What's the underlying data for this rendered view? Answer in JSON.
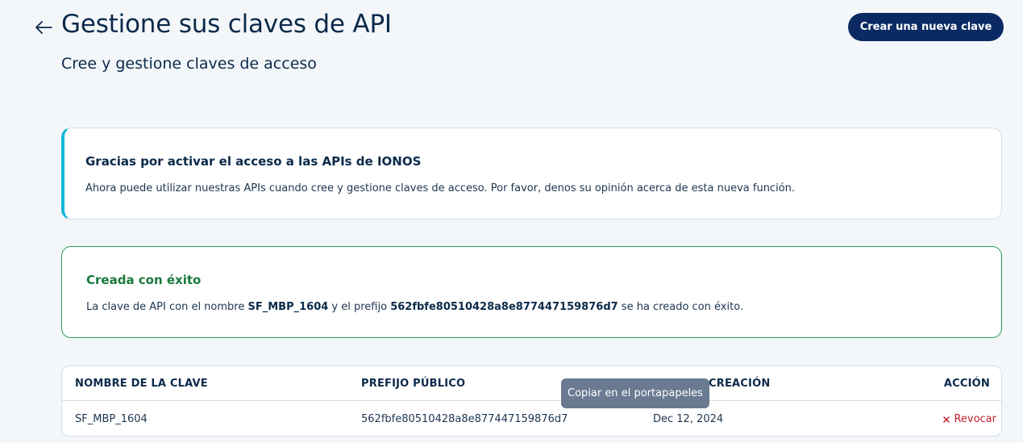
{
  "header": {
    "title": "Gestione sus claves de API",
    "subtitle": "Cree y gestione claves de acceso",
    "create_button_label": "Crear una nueva clave"
  },
  "info_card": {
    "title": "Gracias por activar el acceso a las APIs de IONOS",
    "text": "Ahora puede utilizar nuestras APIs cuando cree y gestione claves de acceso. Por favor, denos su opinión acerca de esta nueva función."
  },
  "success_card": {
    "title": "Creada con éxito",
    "text_before": "La clave de API con el nombre ",
    "key_name": "SF_MBP_1604",
    "text_middle": " y el prefijo ",
    "prefix": "562fbfe80510428a8e877447159876d7",
    "text_after": " se ha creado con éxito."
  },
  "table": {
    "columns": [
      "NOMBRE DE LA CLAVE",
      "PREFIJO PÚBLICO",
      "CREACIÓN",
      "ACCIÓN"
    ],
    "rows": [
      {
        "name": "SF_MBP_1604",
        "prefix": "562fbfe80510428a8e877447159876d7",
        "created": "Dec 12, 2024",
        "action": "Revocar"
      }
    ],
    "tooltip": "Copiar en el portapapeles"
  },
  "colors": {
    "primary": "#0b2a63",
    "info_accent": "#12b6dc",
    "success": "#2d9e5a",
    "danger": "#c0202a"
  },
  "icons": {
    "back": "arrow-left-icon",
    "revoke": "close-icon"
  }
}
